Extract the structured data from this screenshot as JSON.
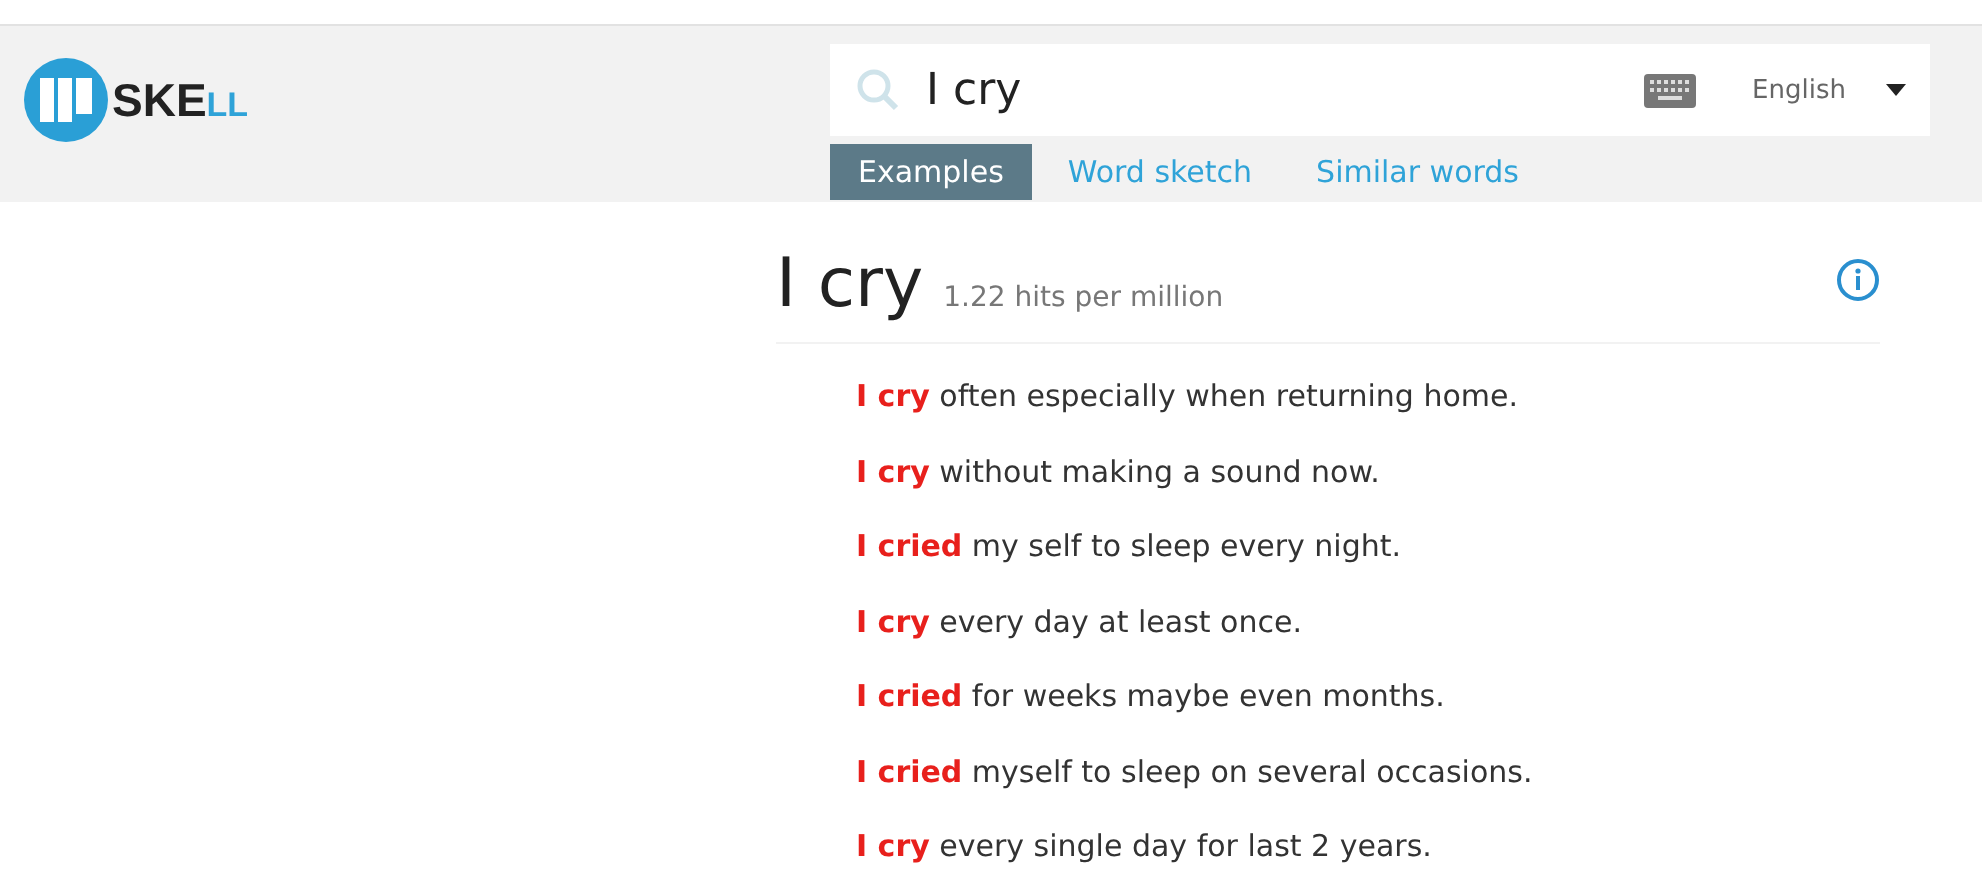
{
  "logo": {
    "main": "SKE",
    "accent": "LL"
  },
  "search": {
    "value": "I cry",
    "language": "English"
  },
  "tabs": [
    {
      "label": "Examples",
      "selected": true
    },
    {
      "label": "Word sketch",
      "selected": false
    },
    {
      "label": "Similar words",
      "selected": false
    }
  ],
  "result": {
    "title": "I cry",
    "frequency": "1.22 hits per million"
  },
  "examples": [
    "**I cry** often especially when returning home.",
    "**I cry** without making a sound now.",
    "**I cried** my self to sleep every night.",
    "**I cry** every day at least once.",
    "**I cried** for weeks maybe even months.",
    "**I cried** myself to sleep on several occasions.",
    "**I cry** every single day for last 2 years."
  ]
}
